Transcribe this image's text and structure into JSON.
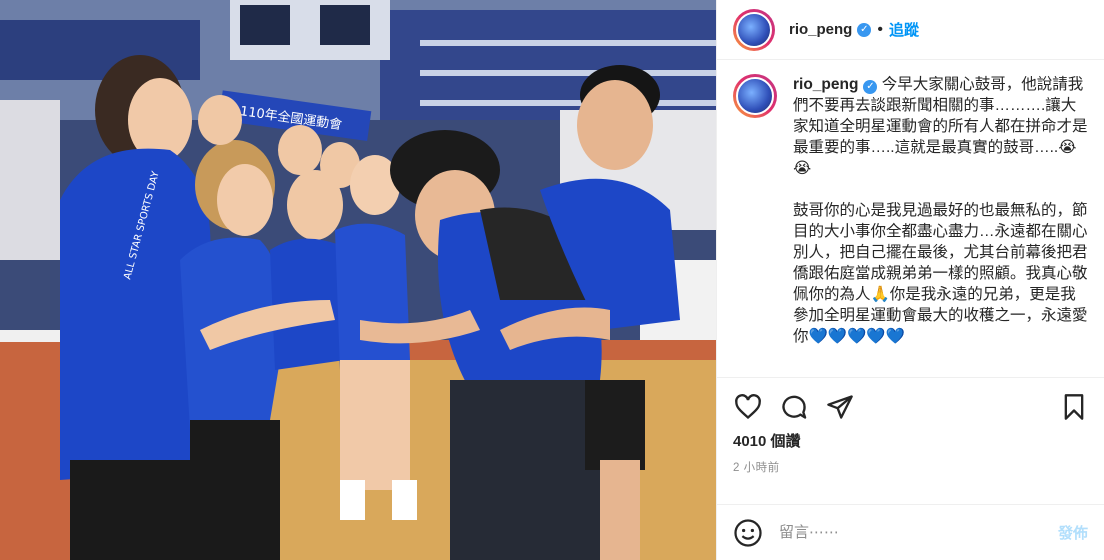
{
  "header": {
    "username": "rio_peng",
    "separator": "•",
    "follow_label": "追蹤"
  },
  "caption": {
    "username": "rio_peng",
    "paragraph1": "今早大家關心鼓哥，他說請我們不要再去談跟新聞相關的事……….讓大家知道全明星運動會的所有人都在拼命才是最重要的事…..這就是最真實的鼓哥…..😭😭",
    "paragraph2a": "鼓哥你的心是我見過最好的也最無私的，節目的大小事你全都盡心盡力…永遠都在關心別人，把自己擺在最後，尤其台前幕後把君僑跟佑庭當成親弟弟一樣的照顧。我真心敬佩你的為人🙏你是我永遠的兄弟，更是我參加全明星運動會最大的收穫之一，永遠愛你",
    "paragraph2b": "💙💙💙💙💙"
  },
  "post": {
    "likes": "4010 個讚",
    "time_ago": "2 小時前"
  },
  "comment": {
    "placeholder": "留言⋯⋯",
    "post_label": "發佈"
  },
  "photo": {
    "banner_text": "110年全國運動會",
    "shirt_text": "ALL STAR SPORTS DAY"
  },
  "icons": {
    "like": "heart-icon",
    "comment": "comment-icon",
    "share": "share-icon",
    "save": "bookmark-icon",
    "emoji": "emoji-icon",
    "verified": "verified-badge-icon"
  },
  "colors": {
    "accent": "#0095f6",
    "verified": "#3897f0",
    "post_disabled": "#b2dffc",
    "jersey_blue": "#1d47c7"
  }
}
